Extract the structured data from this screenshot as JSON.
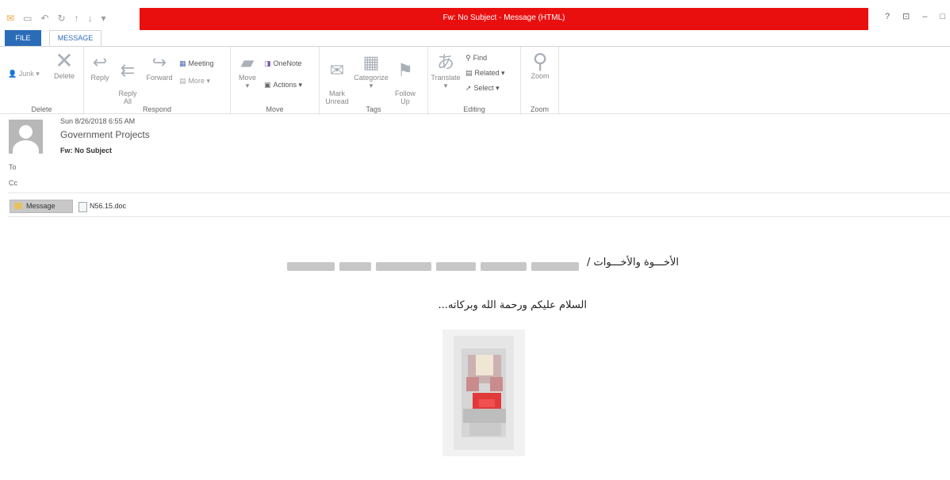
{
  "window": {
    "title": "Fw: No Subject  -  Message (HTML)",
    "accent": "#ea0f0f",
    "controls": [
      "?",
      "⊡",
      "–",
      "□"
    ]
  },
  "tabs": {
    "file": "FILE",
    "message": "MESSAGE"
  },
  "ribbon": {
    "delete_group": {
      "junk": "Junk",
      "delete": "Delete",
      "label": "Delete"
    },
    "respond_group": {
      "reply": "Reply",
      "reply_all": "Reply\nAll",
      "forward": "Forward",
      "meeting": "Meeting",
      "more": "More",
      "label": "Respond"
    },
    "move_group": {
      "move": "Move",
      "onenote": "OneNote",
      "actions": "Actions",
      "label": "Move"
    },
    "tags_group": {
      "mark_unread": "Mark\nUnread",
      "categorize": "Categorize",
      "follow_up": "Follow\nUp",
      "label": "Tags"
    },
    "editing_group": {
      "translate": "Translate",
      "find": "Find",
      "related": "Related",
      "select": "Select",
      "label": "Editing"
    },
    "zoom_group": {
      "zoom": "Zoom",
      "label": "Zoom"
    }
  },
  "header": {
    "date": "Sun 8/26/2018 6:55 AM",
    "from": "Government Projects",
    "subject": "Fw: No Subject",
    "to_label": "To",
    "cc_label": "Cc"
  },
  "attachments": {
    "message": "Message",
    "file": "N56.15.doc"
  },
  "body": {
    "line1": "الأخـــوة والأخـــوات /",
    "line2": "السلام عليكم ورحمة الله وبركاته..."
  }
}
